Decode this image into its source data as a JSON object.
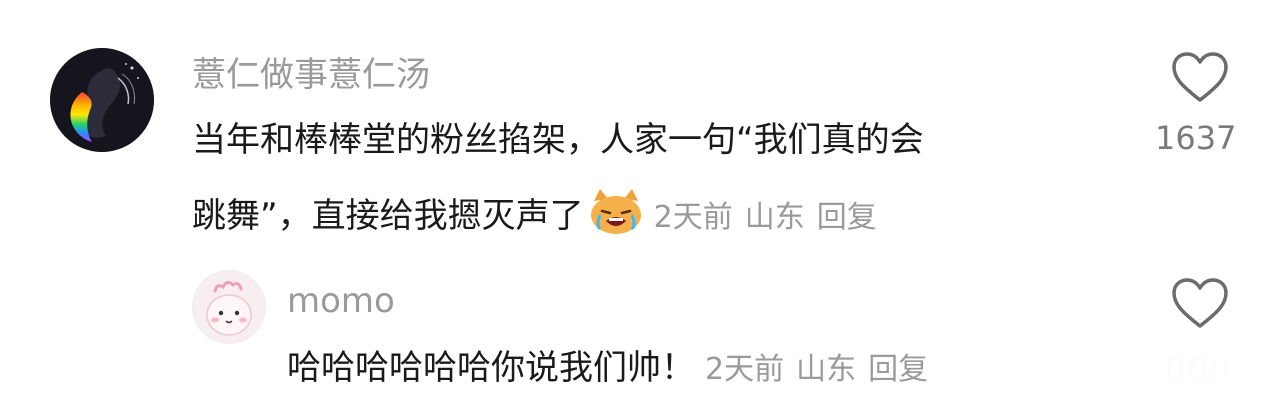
{
  "comment": {
    "username": "薏仁做事薏仁汤",
    "text_line1": "当年和棒棒堂的粉丝掐架，人家一句“我们真的会",
    "text_line2": "跳舞”，直接给我摁灭声了",
    "emoji": "crying-cat-emoji",
    "time": "2天前",
    "location": "山东",
    "reply_label": "回复",
    "likes": "1637"
  },
  "reply": {
    "username": "momo",
    "text": "哈哈哈哈哈哈你说我们帅！",
    "time": "2天前",
    "location": "山东",
    "reply_label": "回复",
    "likes": "000"
  },
  "icons": {
    "like": "heart-outline-icon"
  },
  "colors": {
    "text": "#1a1a1a",
    "meta": "#9a9a9a",
    "count": "#7a7a7a"
  }
}
